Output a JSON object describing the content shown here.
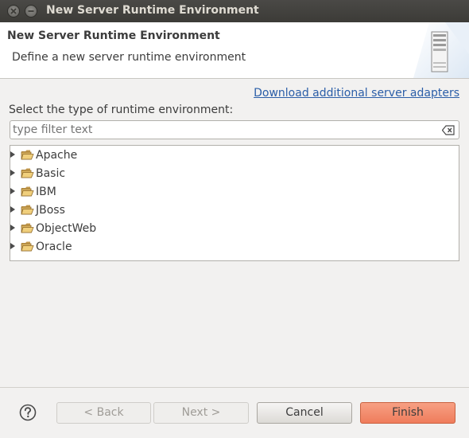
{
  "window": {
    "title": "New Server Runtime Environment"
  },
  "header": {
    "title": "New Server Runtime Environment",
    "description": "Define a new server runtime environment"
  },
  "body": {
    "download_link": "Download additional server adapters",
    "type_label": "Select the type of runtime environment:",
    "filter_placeholder": "type filter text"
  },
  "tree": {
    "items": [
      {
        "label": "Apache"
      },
      {
        "label": "Basic"
      },
      {
        "label": "IBM"
      },
      {
        "label": "JBoss"
      },
      {
        "label": "ObjectWeb"
      },
      {
        "label": "Oracle"
      }
    ]
  },
  "footer": {
    "back_label": "< Back",
    "next_label": "Next >",
    "cancel_label": "Cancel",
    "finish_label": "Finish"
  },
  "icons": {
    "close": "close-icon",
    "minimize": "minimize-icon",
    "server": "server-icon",
    "clear": "clear-icon",
    "folder": "folder-icon",
    "help": "help-icon"
  },
  "colors": {
    "link": "#2b5ea8",
    "finish_button": "#ef7c5c",
    "titlebar": "#3c3b37"
  }
}
